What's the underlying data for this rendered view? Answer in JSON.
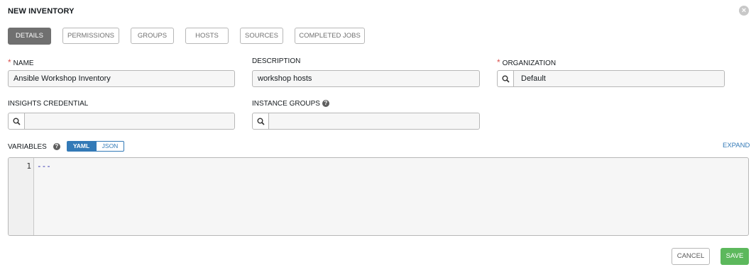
{
  "header": {
    "title": "NEW INVENTORY",
    "close_icon": "close-icon"
  },
  "tabs": [
    {
      "label": "DETAILS",
      "active": true
    },
    {
      "label": "PERMISSIONS",
      "active": false
    },
    {
      "label": "GROUPS",
      "active": false
    },
    {
      "label": "HOSTS",
      "active": false
    },
    {
      "label": "SOURCES",
      "active": false
    },
    {
      "label": "COMPLETED JOBS",
      "active": false
    }
  ],
  "form": {
    "name": {
      "label": "NAME",
      "required": true,
      "value": "Ansible Workshop Inventory"
    },
    "description": {
      "label": "DESCRIPTION",
      "value": "workshop hosts"
    },
    "organization": {
      "label": "ORGANIZATION",
      "required": true,
      "value": "Default"
    },
    "insights_credential": {
      "label": "INSIGHTS CREDENTIAL",
      "value": ""
    },
    "instance_groups": {
      "label": "INSTANCE GROUPS",
      "value": ""
    },
    "variables": {
      "label": "VARIABLES",
      "format_options": [
        "YAML",
        "JSON"
      ],
      "selected_format": "YAML",
      "expand_label": "EXPAND",
      "line_numbers": [
        "1"
      ],
      "content": "---"
    }
  },
  "actions": {
    "cancel_label": "CANCEL",
    "save_label": "SAVE"
  },
  "colors": {
    "accent": "#337ab7",
    "save": "#5cb85c",
    "required": "#d9534f",
    "active_tab": "#707070"
  }
}
